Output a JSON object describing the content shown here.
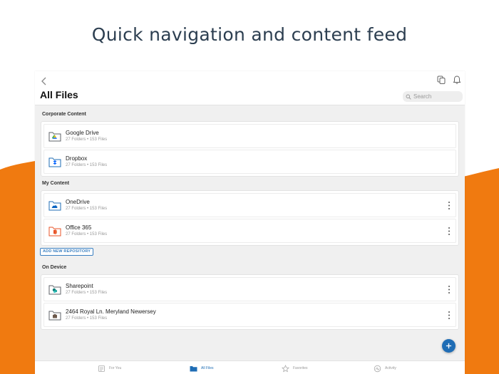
{
  "headline": "Quick navigation and content feed",
  "header": {
    "title": "All Files",
    "search_placeholder": "Search"
  },
  "sections": {
    "corporate": {
      "label": "Corporate Content",
      "items": [
        {
          "name": "Google Drive",
          "meta": "27 Folders • 153 Files",
          "icon": "google-drive-folder-icon"
        },
        {
          "name": "Dropbox",
          "meta": "27 Folders • 153 Files",
          "icon": "dropbox-folder-icon"
        }
      ]
    },
    "my_content": {
      "label": "My Content",
      "items": [
        {
          "name": "OneDrive",
          "meta": "27 Folders • 153 Files",
          "icon": "onedrive-folder-icon"
        },
        {
          "name": "Office 365",
          "meta": "27 Folders • 153 Files",
          "icon": "office365-folder-icon"
        }
      ],
      "add_button": "ADD NEW REPOSITORY"
    },
    "on_device": {
      "label": "On Device",
      "items": [
        {
          "name": "Sharepoint",
          "meta": "27 Folders • 153 Files",
          "icon": "sharepoint-folder-icon"
        },
        {
          "name": "2464 Royal Ln. Meryland Newersey",
          "meta": "27 Folders • 153 Files",
          "icon": "device-folder-icon"
        }
      ]
    }
  },
  "tabs": [
    {
      "label": "For You",
      "icon": "for-you-icon",
      "active": false
    },
    {
      "label": "All Files",
      "icon": "folder-icon",
      "active": true
    },
    {
      "label": "Favorites",
      "icon": "star-icon",
      "active": false
    },
    {
      "label": "Activity",
      "icon": "activity-icon",
      "active": false
    }
  ],
  "colors": {
    "accent": "#1f6db5",
    "orange": "#f07a10",
    "headline": "#2c3e50"
  }
}
